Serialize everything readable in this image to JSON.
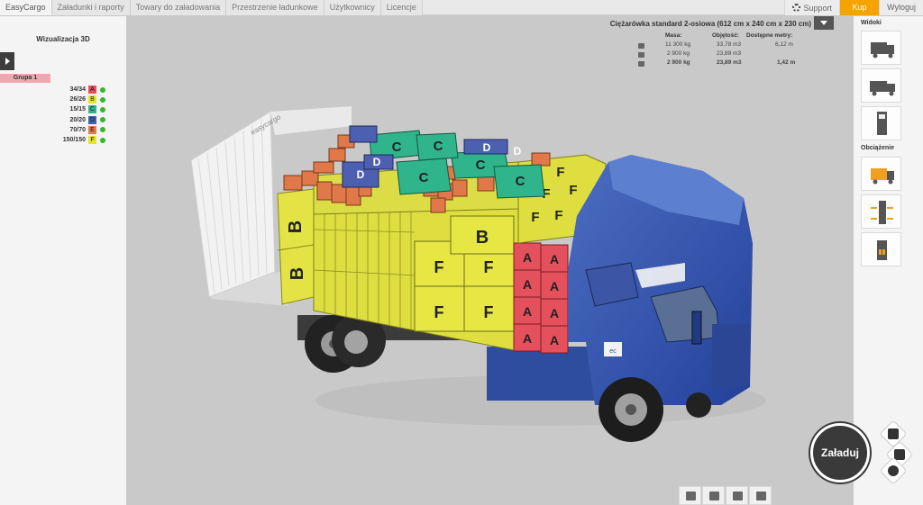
{
  "nav": {
    "tabs": [
      "EasyCargo",
      "Załadunki i raporty",
      "Towary do załadowania",
      "Przestrzenie ładunkowe",
      "Użytkownicy",
      "Licencje"
    ],
    "active_tab": 0,
    "support": "Support",
    "buy": "Kup",
    "logout": "Wyloguj"
  },
  "left": {
    "title": "Wizualizacja 3D",
    "group": "Grupa 1",
    "counts": [
      {
        "count": "34/34",
        "letter": "A",
        "color": "#e8505d"
      },
      {
        "count": "26/26",
        "letter": "B",
        "color": "#e6e629"
      },
      {
        "count": "15/15",
        "letter": "C",
        "color": "#2db98e"
      },
      {
        "count": "20/20",
        "letter": "D",
        "color": "#4b5fb0"
      },
      {
        "count": "70/70",
        "letter": "E",
        "color": "#e57b4d"
      },
      {
        "count": "150/150",
        "letter": "F",
        "color": "#e6e629"
      }
    ]
  },
  "info": {
    "title": "Ciężarówka standard 2-osiowa (612 cm x 240 cm x 230 cm)",
    "headers": {
      "mass": "Masa:",
      "volume": "Objętość:",
      "meters": "Dostępne metry:"
    },
    "rows": [
      {
        "mass": "11 300 kg",
        "volume": "33,78 m3",
        "meters": "6,12 m"
      },
      {
        "mass": "2 900 kg",
        "volume": "23,89 m3",
        "meters": ""
      },
      {
        "mass": "2 900 kg",
        "volume": "23,89 m3",
        "meters": "1,42 m"
      }
    ]
  },
  "right": {
    "views_label": "Widoki",
    "load_label": "Obciążenie"
  },
  "load_button": "Załaduj",
  "truck_brand": "easycargo"
}
